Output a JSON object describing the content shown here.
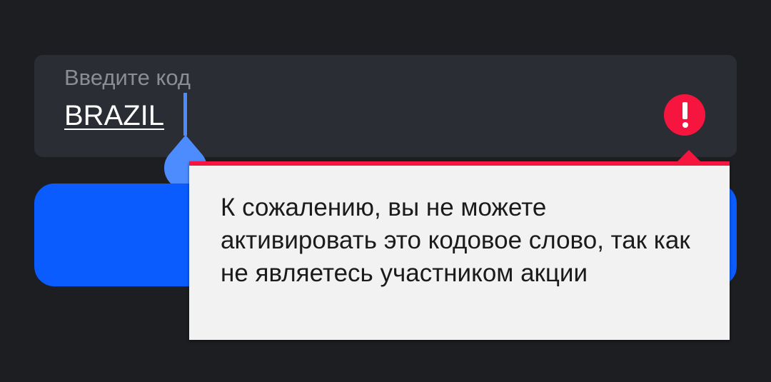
{
  "code_field": {
    "label": "Введите код",
    "value": "BRAZIL",
    "error_icon": "exclamation-circle-icon"
  },
  "submit_button": {
    "label": ""
  },
  "error_tooltip": {
    "message": "К сожалению, вы не можете активировать это кодовое слово, так как не являетесь участником акции"
  },
  "colors": {
    "background": "#1c1e22",
    "field_background": "#2a2d33",
    "accent_blue": "#0a5cff",
    "cursor_blue": "#4d8cff",
    "error_red": "#f5153f",
    "tooltip_background": "#f2f2f2"
  }
}
